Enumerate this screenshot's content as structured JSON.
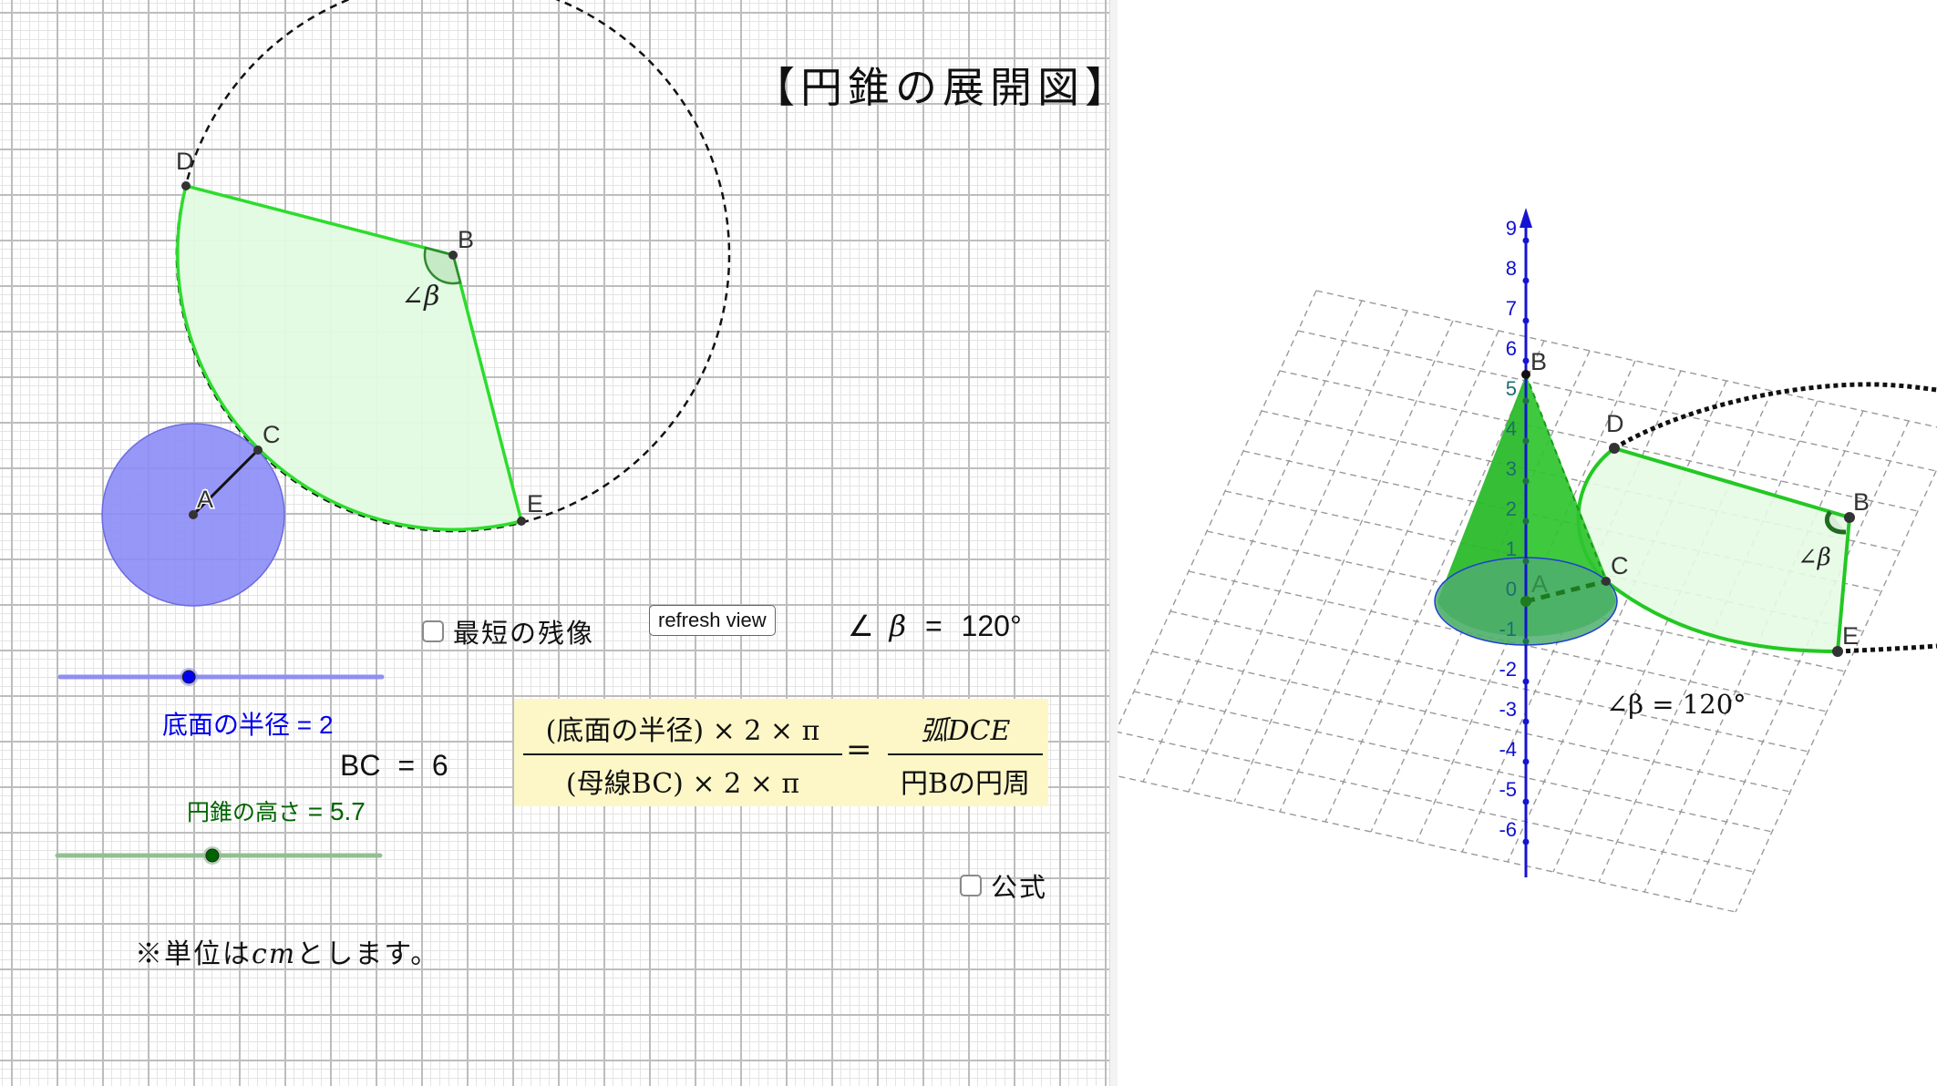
{
  "app": {
    "title": "【円錐の展開図】"
  },
  "net2d": {
    "points": {
      "A": "A",
      "B": "B",
      "C": "C",
      "D": "D",
      "E": "E"
    },
    "angle_label": "∠β",
    "colors": {
      "sector_fill": "#e3fbe1",
      "sector_stroke": "#2ddc2d",
      "base_fill": "#8c8cf7",
      "base_stroke": "#6b6bdf",
      "angle_fill": "#c6e9c6",
      "angle_stroke": "#2e8b2e"
    }
  },
  "controls": {
    "shortest_checkbox": {
      "label": "最短の残像",
      "checked": false
    },
    "refresh_button": "refresh view",
    "angle_readout": {
      "symbol": "∠",
      "var": "β",
      "eq": "=",
      "value": "120°"
    },
    "radius_slider": {
      "label": "底面の半径",
      "eq": " = ",
      "value": "2",
      "fraction": 0.4,
      "color": "#0000ee",
      "track_color": "#8f8ff2"
    },
    "bc_text": {
      "label": "BC",
      "eq": "=",
      "value": "6"
    },
    "height_slider": {
      "label": "円錐の高さ",
      "eq": " = ",
      "value": "5.7",
      "fraction": 0.48,
      "color": "#006400",
      "track_color": "#93c093"
    },
    "formula_checkbox": {
      "label": "公式",
      "checked": false
    }
  },
  "formula": {
    "lhs_num": "(底面の半径) × 2 × π",
    "lhs_den": "(母線BC) × 2 × π",
    "equals": "=",
    "rhs_num": "弧DCE",
    "rhs_den": "円Bの円周"
  },
  "note": {
    "prefix": "※単位は",
    "unit": "cm",
    "suffix": "とします。"
  },
  "view3d": {
    "z_axis_ticks": [
      "9",
      "8",
      "7",
      "6",
      "5",
      "4",
      "3",
      "2",
      "1",
      "0",
      "-1",
      "-2",
      "-3",
      "-4",
      "-5",
      "-6"
    ],
    "points": {
      "A": "A",
      "B": "B",
      "C": "C",
      "D": "D",
      "E": "E"
    },
    "angle_label": "∠β",
    "angle_readout": "∠β = 120°",
    "colors": {
      "axis": "#1414d2",
      "cone": "#2fc42f",
      "base": "#4fae6e",
      "sector_fill": "#e6fbe4",
      "sector_stroke": "#23c823"
    }
  }
}
